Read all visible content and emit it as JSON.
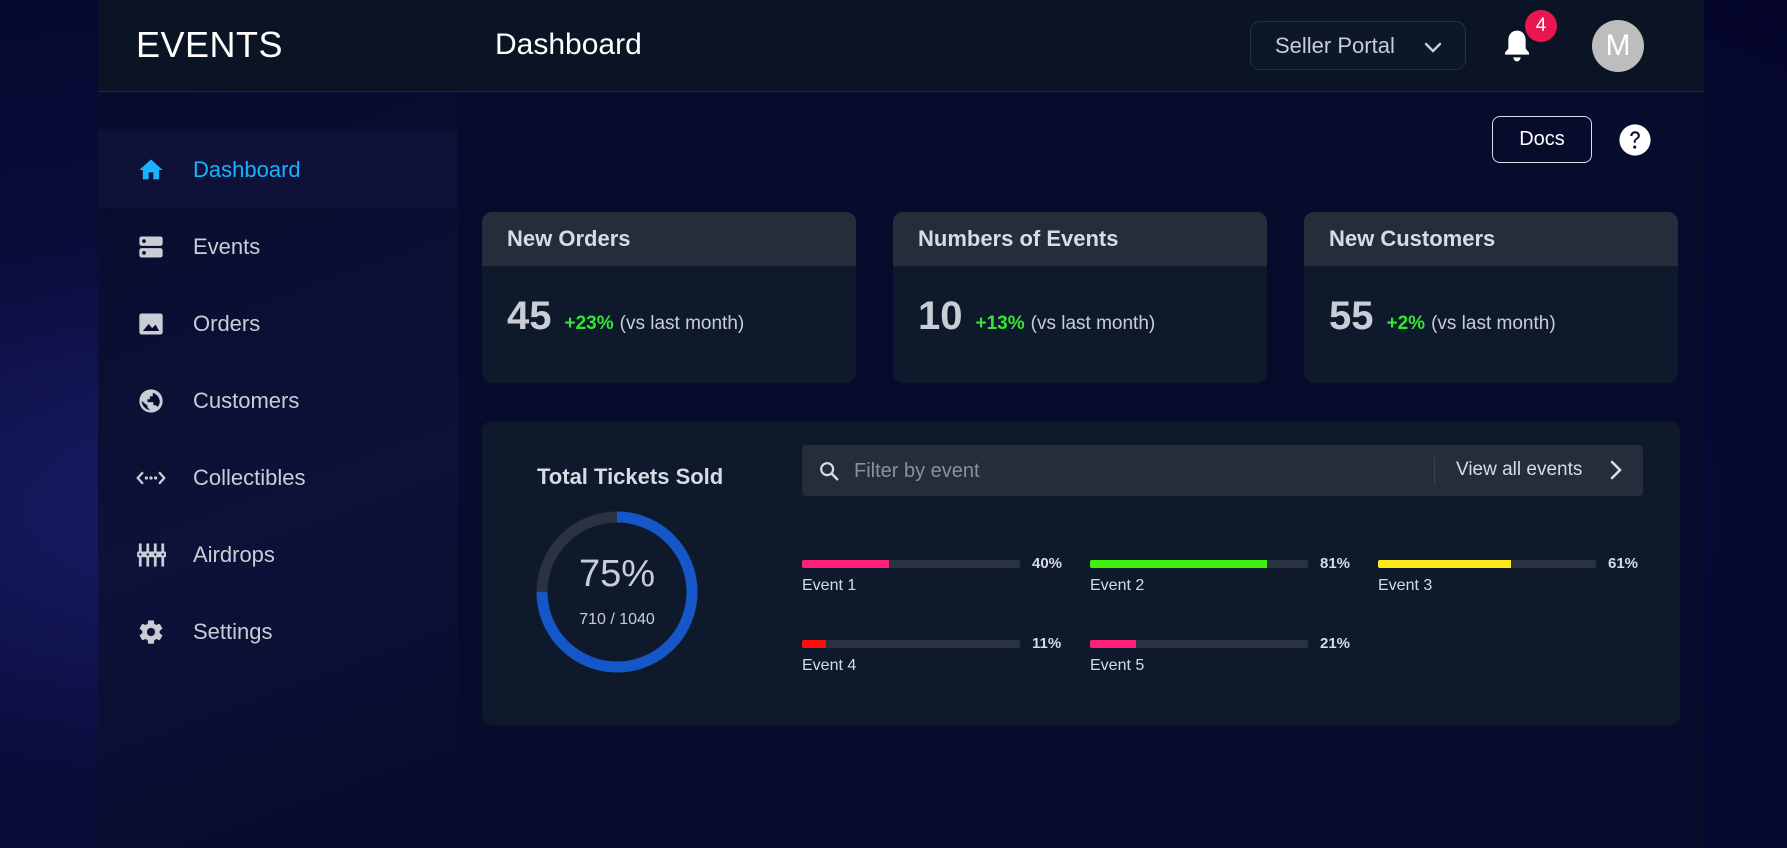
{
  "header": {
    "brand": "EVENTS",
    "page_title": "Dashboard",
    "portal_select": "Seller Portal",
    "notification_count": "4",
    "avatar_initial": "M"
  },
  "sidebar": {
    "items": [
      {
        "label": "Dashboard",
        "icon": "home-icon",
        "active": true
      },
      {
        "label": "Events",
        "icon": "storage-icon"
      },
      {
        "label": "Orders",
        "icon": "image-icon"
      },
      {
        "label": "Customers",
        "icon": "globe-icon"
      },
      {
        "label": "Collectibles",
        "icon": "code-dots-icon"
      },
      {
        "label": "Airdrops",
        "icon": "equalizer-icon"
      },
      {
        "label": "Settings",
        "icon": "gear-icon"
      }
    ]
  },
  "toolbar": {
    "docs_label": "Docs",
    "help_icon": "help-icon"
  },
  "stats": [
    {
      "title": "New Orders",
      "value": "45",
      "change": "+23%",
      "note": "(vs last month)"
    },
    {
      "title": "Numbers of Events",
      "value": "10",
      "change": "+13%",
      "note": "(vs last month)"
    },
    {
      "title": "New Customers",
      "value": "55",
      "change": "+2%",
      "note": "(vs last month)"
    }
  ],
  "tickets": {
    "title": "Total Tickets Sold",
    "percent_label": "75%",
    "percent_value": 0.75,
    "count_label": "710 / 1040",
    "filter_placeholder": "Filter by event",
    "view_all_label": "View all events",
    "events": [
      {
        "name": "Event 1",
        "percent_label": "40%",
        "value": 0.4,
        "color": "#ff1f78"
      },
      {
        "name": "Event 2",
        "percent_label": "81%",
        "value": 0.81,
        "color": "#3df20f"
      },
      {
        "name": "Event 3",
        "percent_label": "61%",
        "value": 0.61,
        "color": "#ffe81a"
      },
      {
        "name": "Event 4",
        "percent_label": "11%",
        "value": 0.11,
        "color": "#ff0d0d"
      },
      {
        "name": "Event 5",
        "percent_label": "21%",
        "value": 0.21,
        "color": "#ff1f78"
      }
    ]
  },
  "colors": {
    "accent": "#1ab2ff",
    "positive": "#32e632",
    "badge": "#e8174f",
    "donut": "#1557c9"
  }
}
